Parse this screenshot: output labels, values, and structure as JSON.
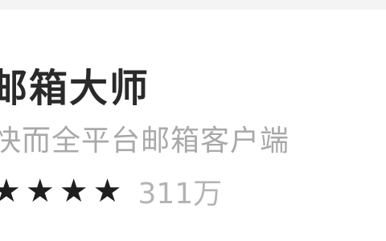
{
  "app": {
    "name": "邮箱大师",
    "description": "快而全平台邮箱客户端",
    "rating": 4,
    "rating_max": 5,
    "downloads": "311万"
  },
  "colors": {
    "title": "#2a2a2a",
    "subtitle": "#a9a9a9",
    "star_filled": "#1f1f1f",
    "count": "#b4b4b4"
  },
  "icons": {
    "star": "star-icon"
  }
}
